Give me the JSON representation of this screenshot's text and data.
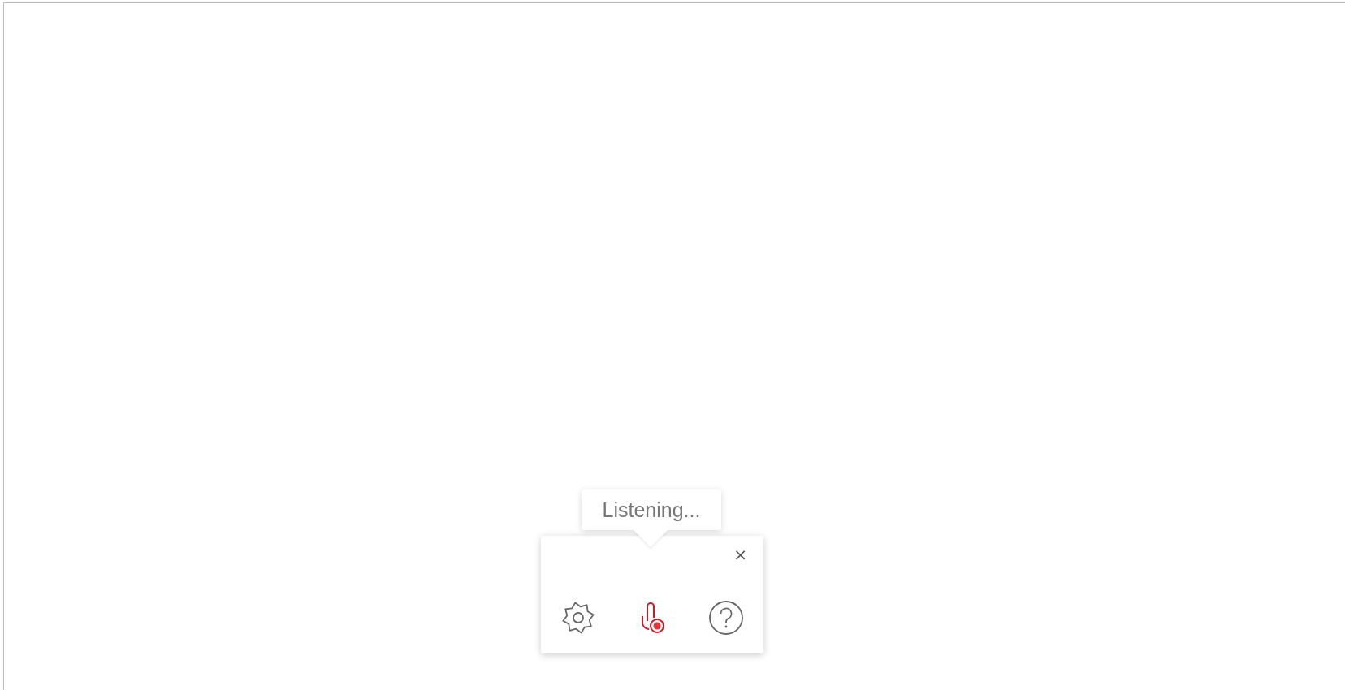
{
  "tooltip": {
    "text": "Listening..."
  },
  "toolbar": {
    "close": "×",
    "buttons": [
      {
        "kind": "settings"
      },
      {
        "kind": "microphone",
        "recording": true
      },
      {
        "kind": "help"
      }
    ]
  }
}
